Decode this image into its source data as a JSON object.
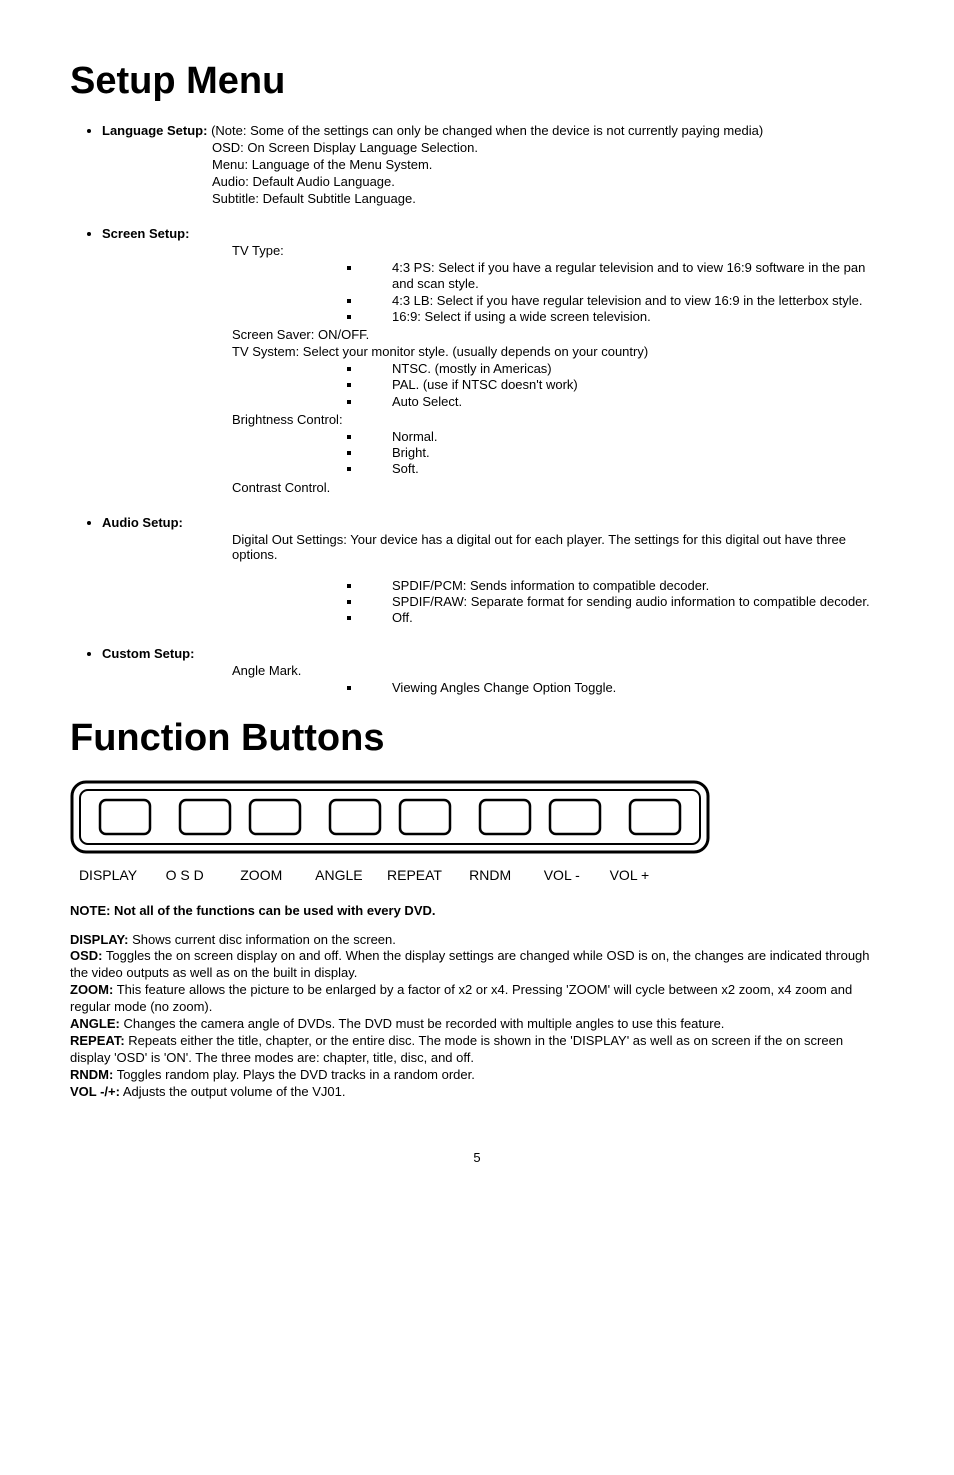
{
  "h1a": "Setup Menu",
  "langSetup": {
    "label": "Language Setup:",
    "note": " (Note:  Some of the settings can only be changed when the device is not currently paying media)",
    "osd": "OSD: On Screen Display Language Selection.",
    "menu": "Menu:  Language of the Menu System.",
    "audio": "Audio: Default Audio Language.",
    "subtitle": "Subtitle: Default Subtitle Language."
  },
  "screenSetup": {
    "label": "Screen Setup:",
    "tvtype": "TV Type:",
    "tv1": "4:3 PS:  Select if you have a regular television and to view 16:9 software in the pan and scan style.",
    "tv2": "4:3 LB:  Select if you have regular television and to view 16:9 in the letterbox style.",
    "tv3": "16:9:  Select if using a wide screen television.",
    "saver": "Screen Saver: ON/OFF.",
    "tvsystem": "TV System:  Select your monitor style.  (usually depends on your country)",
    "sys1": "NTSC. (mostly in Americas)",
    "sys2": "PAL. (use if NTSC doesn't work)",
    "sys3": "Auto Select.",
    "bright": "Brightness Control:",
    "b1": "Normal.",
    "b2": "Bright.",
    "b3": "Soft.",
    "contrast": "Contrast Control."
  },
  "audioSetup": {
    "label": "Audio Setup:",
    "desc": "Digital Out Settings:  Your device has a digital out for each player.  The settings for this digital out have three options.",
    "a1": "SPDIF/PCM:  Sends information to compatible decoder.",
    "a2": "SPDIF/RAW:  Separate format for sending audio information to compatible decoder.",
    "a3": "Off."
  },
  "customSetup": {
    "label": "Custom Setup:",
    "angle": "Angle Mark.",
    "c1": "Viewing Angles Change Option Toggle."
  },
  "h1b": "Function Buttons",
  "btns": {
    "display": "DISPLAY",
    "osd": "O S D",
    "zoom": "ZOOM",
    "angle": "ANGLE",
    "repeat": "REPEAT",
    "rndm": "RNDM",
    "volm": "VOL -",
    "volp": "VOL +"
  },
  "noteLine": "NOTE:  Not all of the functions can be used with every DVD.",
  "funcDesc": {
    "display": {
      "label": "DISPLAY:",
      "txt": "  Shows current disc information on the screen."
    },
    "osd": {
      "label": "OSD:",
      "txt": "  Toggles the on screen display on and off.  When the display settings are changed while OSD is on, the changes are indicated through the video outputs as well as on the built in display."
    },
    "zoom": {
      "label": "ZOOM:",
      "txt": "  This feature allows the picture to be enlarged by a factor of x2 or x4.  Pressing 'ZOOM' will cycle between x2 zoom, x4 zoom and regular mode (no zoom)."
    },
    "angle": {
      "label": "ANGLE:",
      "txt": "  Changes the camera angle of DVDs.  The DVD must be recorded with multiple angles to use this feature."
    },
    "repeat": {
      "label": "REPEAT:",
      "txt": "  Repeats either the title, chapter, or the entire disc.  The mode is shown in the 'DISPLAY' as well as on screen if the on screen display 'OSD' is 'ON'.  The three modes are: chapter, title, disc, and off."
    },
    "rndm": {
      "label": "RNDM:",
      "txt": "  Toggles random play.  Plays the DVD tracks in a random order."
    },
    "vol": {
      "label": "VOL -/+:",
      "txt": "  Adjusts the output volume of the VJ01."
    }
  },
  "pagenum": "5"
}
